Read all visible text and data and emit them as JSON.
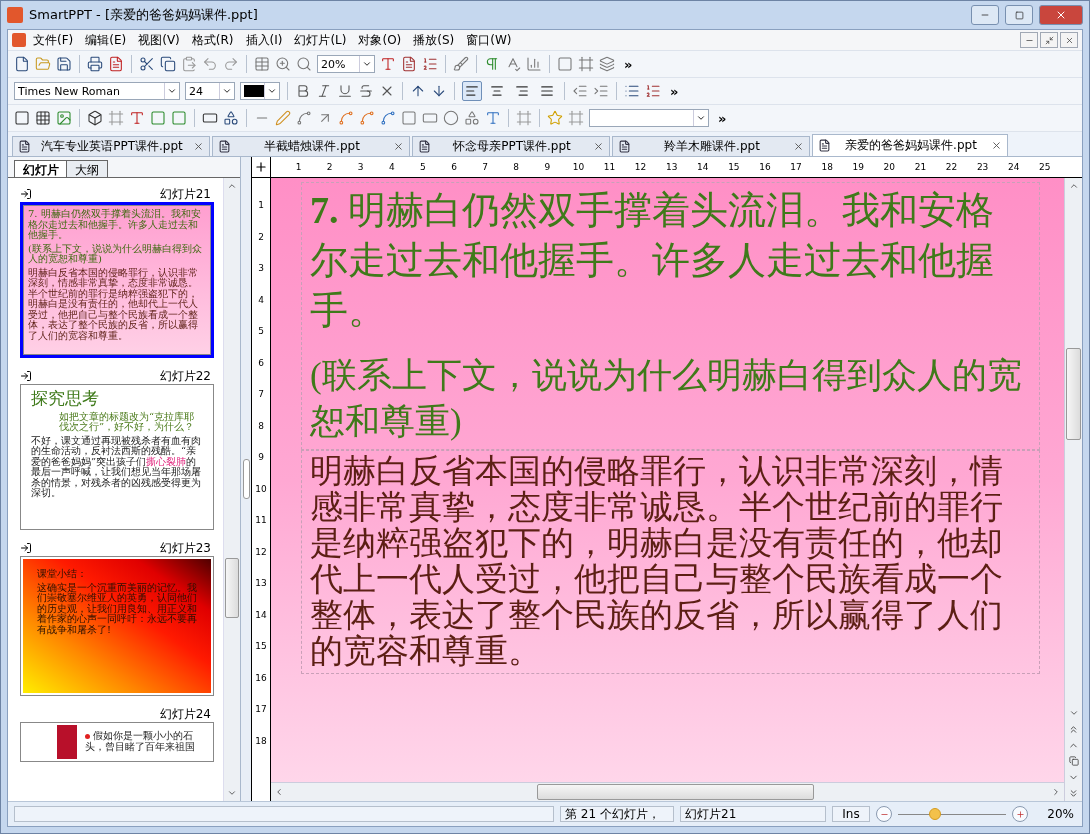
{
  "window": {
    "title": "SmartPPT - [亲爱的爸爸妈妈课件.ppt]"
  },
  "menu": [
    "文件(F)",
    "编辑(E)",
    "视图(V)",
    "格式(R)",
    "插入(I)",
    "幻灯片(L)",
    "对象(O)",
    "播放(S)",
    "窗口(W)"
  ],
  "toolbar": {
    "zoom": "20%",
    "more": "»"
  },
  "format_bar": {
    "font": "Times New Roman",
    "size": "24",
    "more": "»",
    "align": [
      {
        "selected": true
      },
      {
        "selected": false
      },
      {
        "selected": false
      },
      {
        "selected": false
      }
    ]
  },
  "draw_bar": {
    "more": "»"
  },
  "doc_tabs": [
    {
      "label": "汽车专业英语PPT课件.ppt",
      "selected": false
    },
    {
      "label": "半截蜡烛课件.ppt",
      "selected": false
    },
    {
      "label": "怀念母亲PPT课件.ppt",
      "selected": false
    },
    {
      "label": "羚羊木雕课件.ppt",
      "selected": false
    },
    {
      "label": "亲爱的爸爸妈妈课件.ppt",
      "selected": true
    }
  ],
  "panel_tabs": [
    {
      "label": "幻灯片",
      "selected": true
    },
    {
      "label": "大纲",
      "selected": false
    }
  ],
  "slides": [
    {
      "kind": "text",
      "label": "幻灯片21",
      "transition": true,
      "selected": true,
      "title": "7. 明赫白仍然双手撑着头流泪。我和安格尔走过去和他握手。许多人走过去和他握手。",
      "subtitle": "(联系上下文，说说为什么明赫白得到众人的宽恕和尊重)",
      "body": "明赫白反省本国的侵略罪行，认识非常深刻，情感非常真挚，态度非常诚恳。半个世纪前的罪行是纳粹强盗犯下的，明赫白是没有责任的，他却代上一代人受过，他把自己与整个民族看成一个整体，表达了整个民族的反省，所以赢得了人们的宽容和尊重。"
    },
    {
      "kind": "inquiry",
      "label": "幻灯片22",
      "transition": true,
      "selected": false,
      "title": "探究思考",
      "question": "如把文章的标题改为“克拉库耶伐次之行”，好不好，为什么？",
      "body": [
        {
          "text": "不好，课文通过再现被残杀者有血有肉的生命活动，反衬法西斯的残酷。“亲爱的爸爸妈妈”突出孩子们",
          "highlight": false
        },
        {
          "text": "撕心裂肺",
          "highlight": true
        },
        {
          "text": "的最后一声呼喊，让我们想见当年那场屠杀的情景，对残杀者的凶残感受得更为深切。",
          "highlight": false
        }
      ]
    },
    {
      "kind": "summary",
      "label": "幻灯片23",
      "transition": true,
      "selected": false,
      "title": "课堂小结：",
      "body": "这确实是一个沉重而美丽的记忆。我们崇敬塞尔维亚人的英勇，认同他们的历史观，让我们用良知、用正义和着作家的心声一同呼吁：永远不要再有战争和屠杀了!"
    },
    {
      "kind": "photo",
      "label": "幻灯片24",
      "transition": false,
      "selected": false,
      "body": "假如你是一颗小小的石头，曾目睹了百年来祖国"
    }
  ],
  "ruler": {
    "horizontal": [
      "1",
      "2",
      "3",
      "4",
      "5",
      "6",
      "7",
      "8",
      "9",
      "10",
      "11",
      "12",
      "13",
      "14",
      "15",
      "16",
      "17",
      "18",
      "19",
      "20",
      "21",
      "22",
      "23",
      "24",
      "25"
    ],
    "vertical": [
      "1",
      "2",
      "3",
      "4",
      "5",
      "6",
      "7",
      "8",
      "9",
      "10",
      "11",
      "12",
      "13",
      "14",
      "15",
      "16",
      "17",
      "18"
    ]
  },
  "main_slide": {
    "title": "**7.**  明赫白仍然双手撑着头流泪。我和安格尔走过去和他握手。许多人走过去和他握手。",
    "subtitle": "(联系上下文，说说为什么明赫白得到众人的宽恕和尊重)",
    "body": "明赫白反省本国的侵略罪行，认识非常深刻，情感非常真挚，态度非常诚恳。半个世纪前的罪行是纳粹强盗犯下的，明赫白是没有责任的，他却代上一代人受过，他把自己与整个民族看成一个整体，表达了整个民族的反省，所以赢得了人们的宽容和尊重。"
  },
  "status_bar": {
    "cells": [
      "第 21 个幻灯片，",
      "幻灯片21",
      "Ins"
    ],
    "zoom": {
      "level": 0.33,
      "reading": "20%"
    }
  }
}
